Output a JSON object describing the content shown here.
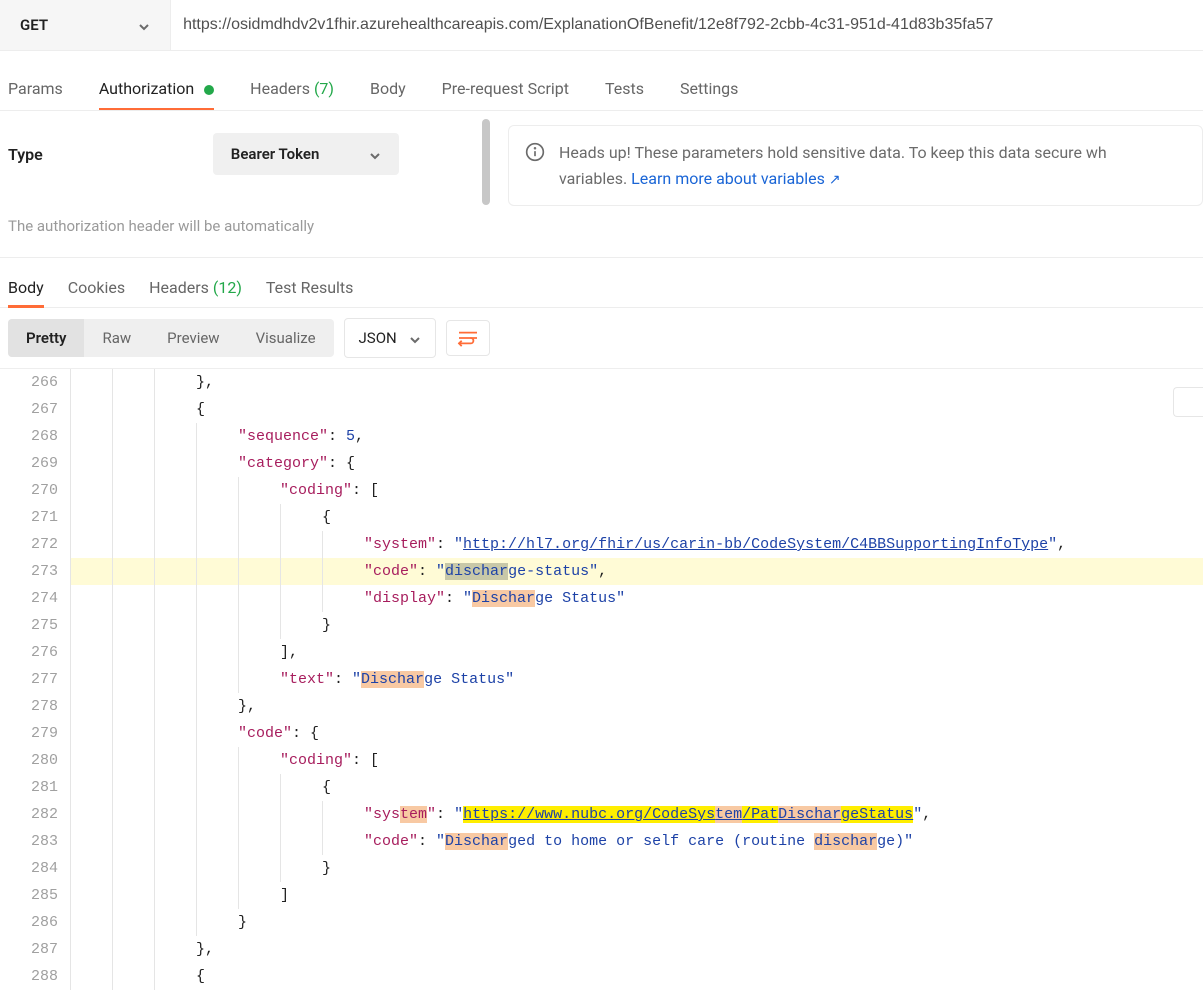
{
  "request": {
    "method": "GET",
    "url": "https://osidmdhdv2v1fhir.azurehealthcareapis.com/ExplanationOfBenefit/12e8f792-2cbb-4c31-951d-41d83b35fa57",
    "tabs": {
      "params": "Params",
      "auth": "Authorization",
      "headers": "Headers",
      "headers_count": "(7)",
      "body": "Body",
      "prereq": "Pre-request Script",
      "tests": "Tests",
      "settings": "Settings"
    }
  },
  "auth": {
    "type_label": "Type",
    "type_value": "Bearer Token",
    "truncated_hint": "The authorization header will be automatically",
    "info_text_1": "Heads up! These parameters hold sensitive data. To keep this data secure wh",
    "info_text_2": "variables.",
    "info_link": "Learn more about variables"
  },
  "response": {
    "tabs": {
      "body": "Body",
      "cookies": "Cookies",
      "headers": "Headers",
      "headers_count": "(12)",
      "test_results": "Test Results"
    },
    "view_modes": {
      "pretty": "Pretty",
      "raw": "Raw",
      "preview": "Preview",
      "visualize": "Visualize"
    },
    "format": "JSON"
  },
  "code": {
    "line_start": 266,
    "lines": [
      {
        "guides": 3,
        "plain": "},",
        "commaAfter": false
      },
      {
        "guides": 3,
        "plain": "{"
      },
      {
        "guides": 4,
        "key": "sequence",
        "num": "5",
        "comma": true
      },
      {
        "guides": 4,
        "key": "category",
        "after": ": {"
      },
      {
        "guides": 5,
        "key": "coding",
        "after": ": ["
      },
      {
        "guides": 6,
        "plain": "{"
      },
      {
        "guides": 7,
        "key": "system",
        "link": "http://hl7.org/fhir/us/carin-bb/CodeSystem/C4BBSupportingInfoType",
        "comma": true
      },
      {
        "guides": 7,
        "key": "code",
        "hlLine": true,
        "segs": [
          {
            "t": "dischar",
            "c": "sel"
          },
          {
            "t": "ge-status"
          }
        ],
        "comma": true
      },
      {
        "guides": 7,
        "key": "display",
        "segs": [
          {
            "t": "Dischar",
            "c": "o"
          },
          {
            "t": "ge Status"
          }
        ]
      },
      {
        "guides": 6,
        "plain": "}"
      },
      {
        "guides": 5,
        "plain": "],"
      },
      {
        "guides": 5,
        "key": "text",
        "segs": [
          {
            "t": "Dischar",
            "c": "o"
          },
          {
            "t": "ge Status"
          }
        ]
      },
      {
        "guides": 4,
        "plain": "},"
      },
      {
        "guides": 4,
        "key": "code",
        "after": ": {"
      },
      {
        "guides": 5,
        "key": "coding",
        "after": ": ["
      },
      {
        "guides": 6,
        "plain": "{"
      },
      {
        "guides": 7,
        "keySegs": [
          {
            "t": "sys"
          },
          {
            "t": "tem",
            "c": "o"
          }
        ],
        "linkSegs": [
          {
            "t": "https://www.nubc.org/CodeSys",
            "c": "y"
          },
          {
            "t": "tem",
            "c": "o"
          },
          {
            "t": "/Pat",
            "c": "y"
          },
          {
            "t": "Dischar",
            "c": "o"
          },
          {
            "t": "geStatus",
            "c": "y"
          }
        ],
        "comma": true,
        "hlY": true
      },
      {
        "guides": 7,
        "key": "code",
        "segs": [
          {
            "t": "Dischar",
            "c": "o"
          },
          {
            "t": "ged to home or self care (routine "
          },
          {
            "t": "dischar",
            "c": "o"
          },
          {
            "t": "ge)"
          }
        ]
      },
      {
        "guides": 6,
        "plain": "}"
      },
      {
        "guides": 5,
        "plain": "]"
      },
      {
        "guides": 4,
        "plain": "}"
      },
      {
        "guides": 3,
        "plain": "},"
      },
      {
        "guides": 3,
        "plain": "{"
      }
    ]
  }
}
